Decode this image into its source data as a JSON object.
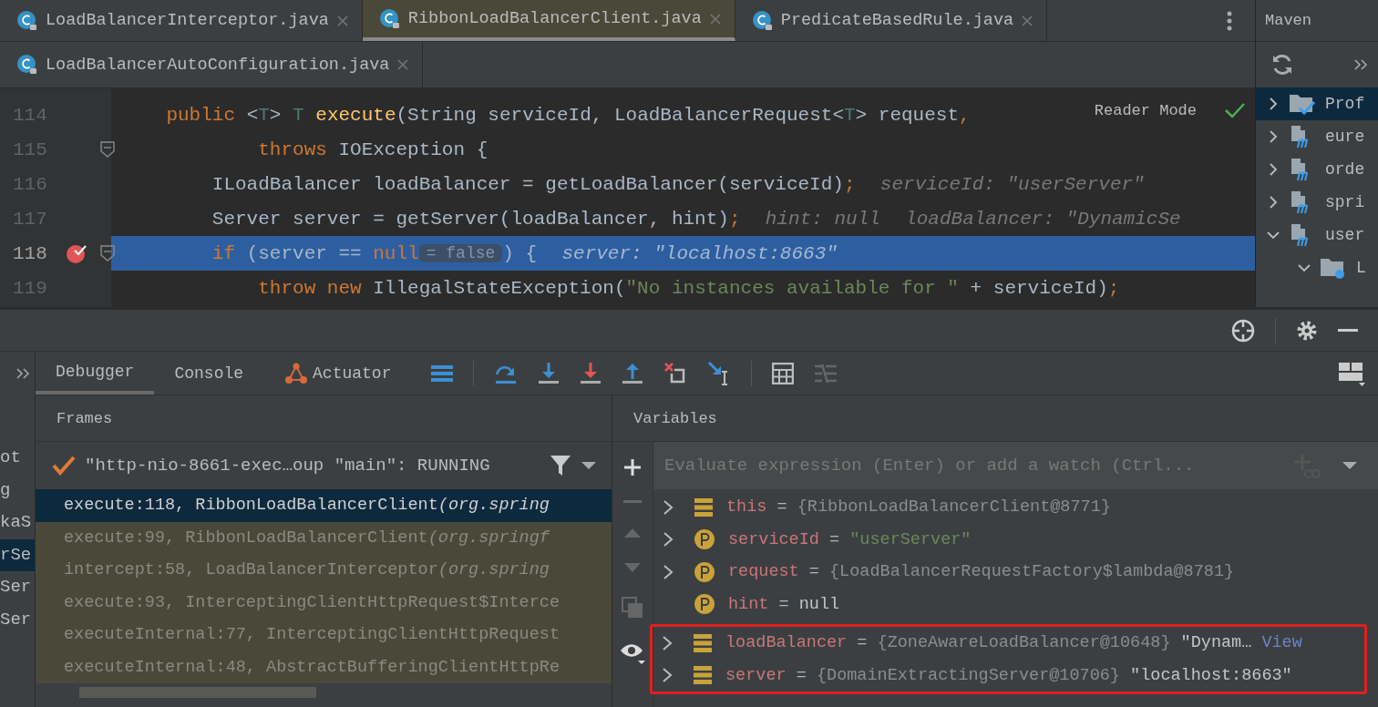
{
  "tab_rows": [
    {
      "tabs": [
        {
          "label": "LoadBalancerInterceptor.java",
          "selected": false
        },
        {
          "label": "RibbonLoadBalancerClient.java",
          "selected": true
        },
        {
          "label": "PredicateBasedRule.java",
          "selected": false
        }
      ]
    },
    {
      "tabs": [
        {
          "label": "LoadBalancerAutoConfiguration.java",
          "selected": false
        }
      ]
    }
  ],
  "code": {
    "reader_mode": "Reader Mode",
    "lines": [
      {
        "number": "114",
        "current": false,
        "breakpoint": false,
        "fold": false,
        "segments": [
          {
            "kind": "code",
            "tokens": [
              {
                "kind": "kw",
                "text": "    public"
              },
              {
                "kind": "plain",
                "text": " <"
              },
              {
                "kind": "type",
                "text": "T"
              },
              {
                "kind": "plain",
                "text": "> "
              },
              {
                "kind": "type",
                "text": "T"
              },
              {
                "kind": "fn",
                "text": " execute"
              },
              {
                "kind": "plain",
                "text": "(String serviceId, LoadBalancerRequest<"
              },
              {
                "kind": "type",
                "text": "T"
              },
              {
                "kind": "plain",
                "text": "> request"
              },
              {
                "kind": "punct",
                "text": ","
              }
            ]
          }
        ]
      },
      {
        "number": "115",
        "current": false,
        "breakpoint": false,
        "fold": true,
        "segments": [
          {
            "kind": "code",
            "tokens": [
              {
                "kind": "kw",
                "text": "            throws"
              },
              {
                "kind": "plain",
                "text": " IOException {"
              }
            ]
          }
        ]
      },
      {
        "number": "116",
        "current": false,
        "breakpoint": false,
        "fold": false,
        "segments": [
          {
            "kind": "code",
            "tokens": [
              {
                "kind": "plain",
                "text": "        ILoadBalancer loadBalancer = getLoadBalancer(serviceId)"
              },
              {
                "kind": "punct",
                "text": ";"
              }
            ]
          },
          {
            "kind": "hint",
            "text": "serviceId: \"userServer\""
          }
        ]
      },
      {
        "number": "117",
        "current": false,
        "breakpoint": false,
        "fold": false,
        "segments": [
          {
            "kind": "code",
            "tokens": [
              {
                "kind": "plain",
                "text": "        Server server = getServer(loadBalancer, hint)"
              },
              {
                "kind": "punct",
                "text": ";"
              }
            ]
          },
          {
            "kind": "hint",
            "text": "hint: null"
          },
          {
            "kind": "hint",
            "text": "loadBalancer: \"DynamicSe"
          }
        ]
      },
      {
        "number": "118",
        "current": true,
        "breakpoint": true,
        "fold": true,
        "segments": [
          {
            "kind": "code",
            "tokens": [
              {
                "kind": "kw",
                "text": "        if"
              },
              {
                "kind": "plain",
                "text": " (server == "
              },
              {
                "kind": "kw",
                "text": "null"
              }
            ]
          },
          {
            "kind": "inline_value",
            "text": "= false"
          },
          {
            "kind": "code",
            "tokens": [
              {
                "kind": "plain",
                "text": ") {"
              }
            ]
          },
          {
            "kind": "hint",
            "text": "server: \"localhost:8663\""
          }
        ]
      },
      {
        "number": "119",
        "current": false,
        "breakpoint": false,
        "fold": false,
        "segments": [
          {
            "kind": "code",
            "tokens": [
              {
                "kind": "kw",
                "text": "            throw new"
              },
              {
                "kind": "plain",
                "text": " IllegalStateException("
              },
              {
                "kind": "string",
                "text": "\"No instances available for \""
              },
              {
                "kind": "plain",
                "text": " + serviceId)"
              },
              {
                "kind": "punct",
                "text": ";"
              }
            ]
          }
        ]
      }
    ]
  },
  "maven": {
    "title": "Maven",
    "tree": [
      {
        "label": "Prof",
        "kind": "profiles",
        "expanded": false,
        "selected": true
      },
      {
        "label": "eure",
        "kind": "module",
        "expanded": false,
        "selected": false
      },
      {
        "label": "orde",
        "kind": "module",
        "expanded": false,
        "selected": false
      },
      {
        "label": "spri",
        "kind": "module",
        "expanded": false,
        "selected": false
      },
      {
        "label": "user",
        "kind": "module",
        "expanded": true,
        "selected": false,
        "children": [
          {
            "label": "L",
            "kind": "folder",
            "expanded": true,
            "selected": false
          }
        ]
      }
    ]
  },
  "strip_labels": [
    {
      "text": "ot",
      "selected": false
    },
    {
      "text": "g",
      "selected": false
    },
    {
      "text": "kaS",
      "selected": false
    },
    {
      "text": "rSe",
      "selected": true
    },
    {
      "text": "Ser",
      "selected": false
    },
    {
      "text": "Ser",
      "selected": false
    }
  ],
  "debug_tabs": [
    {
      "label": "Debugger",
      "selected": true,
      "kind": "text"
    },
    {
      "label": "Console",
      "selected": false,
      "kind": "text"
    },
    {
      "label": "Actuator",
      "selected": false,
      "kind": "actuator"
    }
  ],
  "frames": {
    "title": "Frames",
    "thread": "\"http-nio-8661-exec…oup \"main\": RUNNING",
    "rows": [
      {
        "location": "execute:118, RibbonLoadBalancerClient",
        "package": "(org.spring",
        "selected": true,
        "dimmed": false
      },
      {
        "location": "execute:99, RibbonLoadBalancerClient",
        "package": "(org.springf",
        "selected": false,
        "dimmed": true
      },
      {
        "location": "intercept:58, LoadBalancerInterceptor",
        "package": "(org.spring",
        "selected": false,
        "dimmed": true
      },
      {
        "location": "execute:93, InterceptingClientHttpRequest$Interce",
        "selected": false,
        "dimmed": true
      },
      {
        "location": "executeInternal:77, InterceptingClientHttpRequest",
        "selected": false,
        "dimmed": true
      },
      {
        "location": "executeInternal:48, AbstractBufferingClientHttpRe",
        "selected": false,
        "dimmed": true
      }
    ]
  },
  "variables": {
    "title": "Variables",
    "evaluate": {
      "placeholder": "Evaluate expression (Enter) or add a watch (Ctrl..."
    },
    "rows": [
      {
        "expandable": true,
        "kind": "field",
        "name": "this",
        "operator": "=",
        "value": [
          {
            "kind": "object",
            "text": "{RibbonLoadBalancerClient@8771}"
          }
        ]
      },
      {
        "expandable": true,
        "kind": "param",
        "name": "serviceId",
        "operator": "=",
        "value": [
          {
            "kind": "string",
            "text": "\"userServer\""
          }
        ]
      },
      {
        "expandable": true,
        "kind": "param",
        "name": "request",
        "operator": "=",
        "value": [
          {
            "kind": "object",
            "text": "{LoadBalancerRequestFactory$lambda@8781}"
          }
        ]
      },
      {
        "expandable": false,
        "kind": "param",
        "name": "hint",
        "operator": "=",
        "value": [
          {
            "kind": "plain",
            "text": "null"
          }
        ]
      }
    ],
    "marked_rows": [
      {
        "expandable": true,
        "kind": "field",
        "name": "loadBalancer",
        "operator": "=",
        "value": [
          {
            "kind": "object",
            "text": "{ZoneAwareLoadBalancer@10648}"
          },
          {
            "kind": "plain",
            "text": "\"Dynam…"
          },
          {
            "kind": "link",
            "text": "View"
          }
        ]
      },
      {
        "expandable": true,
        "kind": "field",
        "name": "server",
        "operator": "=",
        "value": [
          {
            "kind": "object",
            "text": "{DomainExtractingServer@10706}"
          },
          {
            "kind": "plain",
            "text": "\"localhost:8663\""
          }
        ]
      }
    ]
  }
}
